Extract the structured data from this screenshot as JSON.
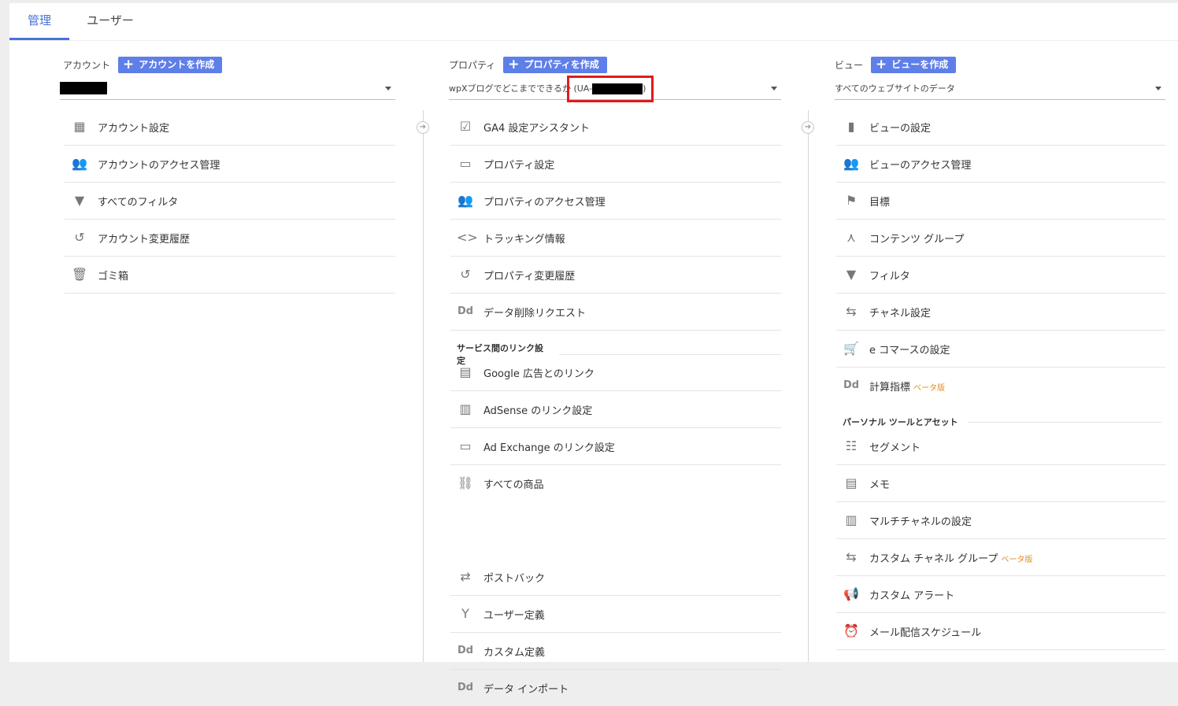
{
  "tabs": [
    {
      "label": "管理",
      "active": true
    },
    {
      "label": "ユーザー",
      "active": false
    }
  ],
  "account": {
    "label": "アカウント",
    "create_label": "アカウントを作成",
    "items": [
      {
        "icon": "building-icon",
        "label": "アカウント設定"
      },
      {
        "icon": "people-icon",
        "label": "アカウントのアクセス管理"
      },
      {
        "icon": "filter-icon",
        "label": "すべてのフィルタ"
      },
      {
        "icon": "history-icon",
        "label": "アカウント変更履歴"
      },
      {
        "icon": "trash-icon",
        "label": "ゴミ箱"
      }
    ]
  },
  "property": {
    "label": "プロパティ",
    "create_label": "プロパティを作成",
    "selected_prefix": "wpXブログでどこまでできるか (UA-",
    "selected_suffix": ")",
    "items": [
      {
        "icon": "checklist-icon",
        "label": "GA4 設定アシスタント"
      },
      {
        "icon": "layout-icon",
        "label": "プロパティ設定"
      },
      {
        "icon": "people-icon",
        "label": "プロパティのアクセス管理"
      },
      {
        "icon": "code-icon",
        "label": "トラッキング情報"
      },
      {
        "icon": "history-icon",
        "label": "プロパティ変更履歴"
      },
      {
        "icon": "dd-icon",
        "label": "データ削除リクエスト"
      }
    ],
    "section_title": "サービス間のリンク設定",
    "link_items": [
      {
        "icon": "ads-icon",
        "label": "Google 広告とのリンク"
      },
      {
        "icon": "adsense-icon",
        "label": "AdSense のリンク設定"
      },
      {
        "icon": "layout-icon",
        "label": "Ad Exchange のリンク設定"
      },
      {
        "icon": "link-icon",
        "label": "すべての商品"
      }
    ],
    "more_items": [
      {
        "icon": "postback-icon",
        "label": "ポストバック"
      },
      {
        "icon": "fork-icon",
        "label": "ユーザー定義"
      },
      {
        "icon": "dd-icon",
        "label": "カスタム定義"
      },
      {
        "icon": "dd-icon",
        "label": "データ インポート"
      }
    ]
  },
  "view": {
    "label": "ビュー",
    "create_label": "ビューを作成",
    "selected": "すべてのウェブサイトのデータ",
    "items": [
      {
        "icon": "document-icon",
        "label": "ビューの設定"
      },
      {
        "icon": "people-icon",
        "label": "ビューのアクセス管理"
      },
      {
        "icon": "flag-icon",
        "label": "目標"
      },
      {
        "icon": "content-group-icon",
        "label": "コンテンツ グループ"
      },
      {
        "icon": "filter-icon",
        "label": "フィルタ"
      },
      {
        "icon": "channel-icon",
        "label": "チャネル設定"
      },
      {
        "icon": "cart-icon",
        "label": "e コマースの設定"
      },
      {
        "icon": "dd-icon",
        "label": "計算指標",
        "beta": "ベータ版"
      }
    ],
    "section_title": "パーソナル ツールとアセット",
    "tool_items": [
      {
        "icon": "segment-icon",
        "label": "セグメント"
      },
      {
        "icon": "memo-icon",
        "label": "メモ"
      },
      {
        "icon": "bar-icon",
        "label": "マルチチャネルの設定"
      },
      {
        "icon": "channel-icon",
        "label": "カスタム チャネル グループ",
        "beta": "ベータ版"
      },
      {
        "icon": "megaphone-icon",
        "label": "カスタム アラート"
      },
      {
        "icon": "clock-icon",
        "label": "メール配信スケジュール"
      }
    ]
  }
}
